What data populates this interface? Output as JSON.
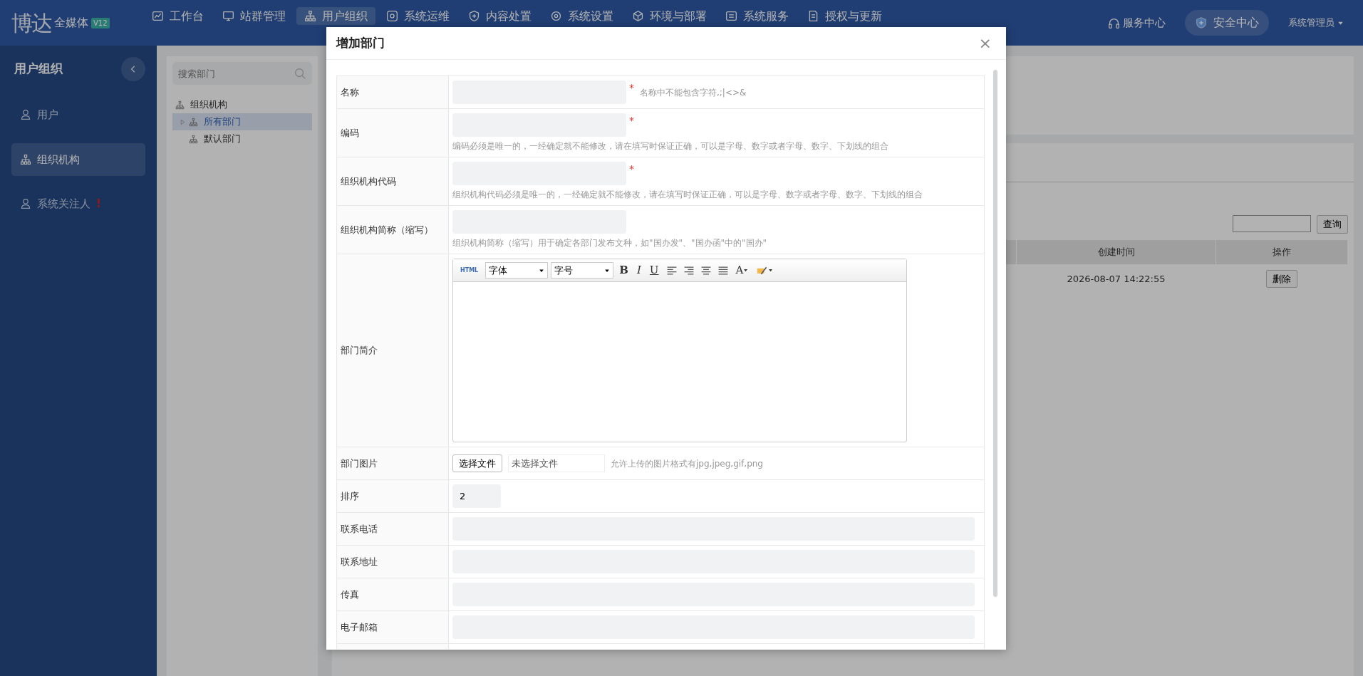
{
  "brand": {
    "name": "博达",
    "product": "全媒体",
    "version": "V12"
  },
  "nav": [
    {
      "label": "工作台",
      "selected": false
    },
    {
      "label": "站群管理",
      "selected": false
    },
    {
      "label": "用户组织",
      "selected": true
    },
    {
      "label": "系统运维",
      "selected": false
    },
    {
      "label": "内容处置",
      "selected": false
    },
    {
      "label": "系统设置",
      "selected": false
    },
    {
      "label": "环境与部署",
      "selected": false
    },
    {
      "label": "系统服务",
      "selected": false
    },
    {
      "label": "授权与更新",
      "selected": false
    }
  ],
  "nav_right": {
    "service": "服务中心",
    "security": "安全中心",
    "user": "系统管理员"
  },
  "sidebar": {
    "title": "用户组织",
    "items": [
      {
        "label": "用户",
        "selected": false
      },
      {
        "label": "组织机构",
        "selected": true
      },
      {
        "label": "系统关注人",
        "selected": false,
        "alert": "!"
      }
    ]
  },
  "tree": {
    "placeholder": "搜索部门",
    "nodes": [
      {
        "label": "组织机构",
        "selected": false,
        "children": [
          {
            "label": "所有部门",
            "selected": true,
            "expanded": false
          },
          {
            "label": "默认部门",
            "selected": false
          }
        ]
      }
    ]
  },
  "list": {
    "search_button": "查询",
    "columns": [
      "创建时间",
      "操作"
    ],
    "rows": [
      {
        "created": "2026-08-07 14:22:55",
        "action": "删除"
      }
    ]
  },
  "dialog": {
    "title": "增加部门",
    "close": "×",
    "fields": [
      {
        "label": "名称",
        "kind": "text",
        "required_mark": "*",
        "inline_hint": "名称中不能包含字符,;|<>&"
      },
      {
        "label": "编码",
        "kind": "text",
        "required_mark": "*",
        "hint": "编码必须是唯一的，一经确定就不能修改，请在填写时保证正确，可以是字母、数字或者字母、数字、下划线的组合"
      },
      {
        "label": "组织机构代码",
        "kind": "text",
        "required_mark": "*",
        "hint": "组织机构代码必须是唯一的，一经确定就不能修改，请在填写时保证正确，可以是字母、数字或者字母、数字、下划线的组合"
      },
      {
        "label": "组织机构简称（缩写）",
        "kind": "text",
        "hint": "组织机构简称（缩写）用于确定各部门发布文种，如\"国办发\"、\"国办函\"中的\"国办\""
      },
      {
        "label": "部门简介",
        "kind": "editor",
        "html_label": "HTML",
        "font_select": "字体",
        "size_select": "字号",
        "format_buttons": [
          "B",
          "I",
          "U"
        ],
        "color_button": "A"
      },
      {
        "label": "部门图片",
        "kind": "file",
        "button": "选择文件",
        "file_name": "未选择文件",
        "hint": "允许上传的图片格式有jpg,jpeg,gif,png"
      },
      {
        "label": "排序",
        "kind": "number",
        "value": "2"
      },
      {
        "label": "联系电话",
        "kind": "wide"
      },
      {
        "label": "联系地址",
        "kind": "wide"
      },
      {
        "label": "传真",
        "kind": "wide"
      },
      {
        "label": "电子邮箱",
        "kind": "wide"
      }
    ]
  }
}
